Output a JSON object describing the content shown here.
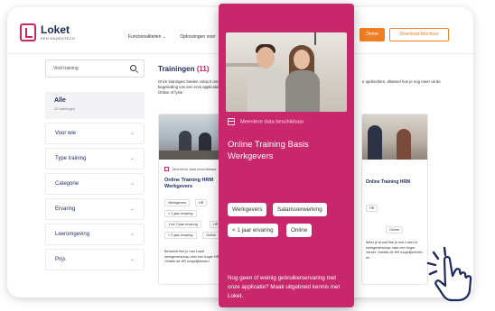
{
  "header": {
    "logo_name": "Loket",
    "logo_sub": "EEN ENDEDTECH",
    "nav": [
      "Functionaliteiten ⌄",
      "Oplossingen voor"
    ],
    "demo_button": "Demo",
    "brochure_button": "Download brochure"
  },
  "sidebar": {
    "search_placeholder": "Vind training",
    "all": {
      "label": "Alle",
      "sub": "22 trainingen"
    },
    "filters": [
      "Voor wie",
      "Type training",
      "Categorie",
      "Ervaring",
      "Leeromgeving",
      "Prijs"
    ]
  },
  "main": {
    "title": "Trainingen",
    "count": "(11)",
    "intro_left": "Onze trainingen bieden volop k onder begeleiding van een erva applicatie haalt. Online of fysie",
    "intro_right": "e opdrachten, afwissel hoe je nog meer uit de"
  },
  "card_left": {
    "date": "Meerdere data beschikbaar",
    "title": "Online Training HRM Werkgevers",
    "tags": [
      "Werkgevers",
      "HR",
      "< 1 jaar ervaring",
      "1 tot 2 jaar ervaring",
      "HR",
      "> 2 jaar ervaring",
      "Online"
    ],
    "desc": "Beheerst fine je met Loket werkgeverschap veel een hoger HR? Ontdek de HR mogelijkheden"
  },
  "card_right": {
    "title": "Online Training HRM",
    "tags": [
      "HR",
      "Online"
    ],
    "desc": "Weet je al wat fine je met Loket nl werkgeverschap naar een hoger. Vereer. Ontdek de HR mogelijkheden en"
  },
  "overlay": {
    "date": "Meerdere data beschikbaar",
    "title": "Online Training Basis Werkgevers",
    "tags": [
      "Werkgevers",
      "Salarisverwerking",
      "< 1 jaar ervaring",
      "Online"
    ],
    "footer": "Nog geen of weinig gebruikerservaring met onze applicatie? Maak uitgebreid kennis met Loket."
  },
  "colors": {
    "brand_pink": "#c8276b",
    "brand_navy": "#1f2a5c",
    "accent_orange": "#f07e22"
  }
}
